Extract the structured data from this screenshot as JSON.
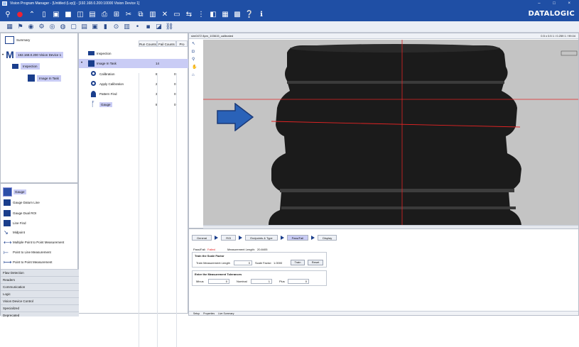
{
  "window": {
    "title": "Vision Program Manager - [Untitled (Lvp)] - [192.168.0.200:10000 Vision Device 1]",
    "controls": "– □ ×"
  },
  "brand": "DATALOGIC",
  "tree": {
    "summary": "Summary",
    "device": "192.168.0.200 Vision Device 1",
    "inspection": "Inspection",
    "image_in_task": "Image In Task"
  },
  "grid": {
    "headers": [
      "Run Counts",
      "Fail Counts",
      "Pro"
    ],
    "rows": [
      {
        "label": "Inspection",
        "v1": "",
        "v2": ""
      },
      {
        "label": "Image In Task",
        "v1": "14",
        "v2": ""
      },
      {
        "label": "Calibration",
        "v1": "8",
        "v2": "0"
      },
      {
        "label": "Apply Calibration",
        "v1": "2",
        "v2": "0"
      },
      {
        "label": "Pattern Find",
        "v1": "3",
        "v2": "0"
      },
      {
        "label": "Gauge",
        "v1": "8",
        "v2": "0"
      }
    ]
  },
  "tools": {
    "items": [
      "Gauge",
      "Gauge Datum Line",
      "Gauge Dual ROI",
      "Line Find",
      "Midpoint",
      "Multiple Point to Point Measurement",
      "Point to Line Measurement",
      "Point to Point Measurement"
    ],
    "categories": [
      "Flaw Detection",
      "Readers",
      "Communication",
      "Logic",
      "Vision Device Control",
      "Specialized",
      "Deprecated"
    ]
  },
  "image": {
    "header_left": "sim0472 8pm_103615_calibrated",
    "header_right": "0.5 x 0.5   1 / 0.259   1 / 99.04"
  },
  "props": {
    "tabs": [
      "General",
      "ROI",
      "Endpoints & Type",
      "Pass/Fail",
      "Display"
    ],
    "passfail_label": "Pass/Fail:",
    "passfail_value": "Failed",
    "measurement_label": "Measurement Length:",
    "measurement_value": "20.8405",
    "train_header": "Train the Scale Factor",
    "train_measure_label": "Train Measurement Length",
    "train_measure_value": "0",
    "scale_factor_label": "Scale Factor:",
    "scale_factor_value": "1.0000",
    "train_btn": "Train",
    "reset_btn": "Reset",
    "tol_header": "Enter the Measurement Tolerances",
    "minus_label": "Minus",
    "minus_value": "0",
    "nominal_label": "Nominal",
    "nominal_value": "1",
    "plus_label": "Plus",
    "plus_value": "0",
    "bottom_tabs": [
      "Setup",
      "Properties",
      "Live Summary"
    ]
  }
}
